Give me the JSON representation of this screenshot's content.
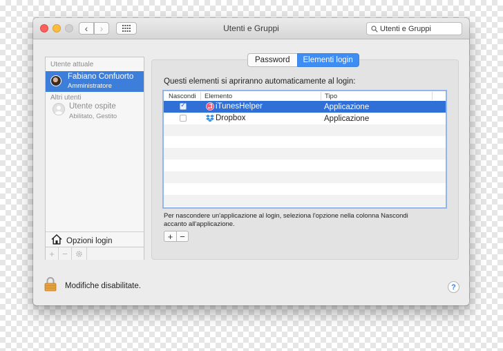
{
  "window": {
    "title": "Utenti e Gruppi",
    "search_value": "Utenti e Gruppi"
  },
  "sidebar": {
    "current_user_header": "Utente attuale",
    "current_user": {
      "name": "Fabiano Confuorto",
      "role": "Amministratore"
    },
    "other_users_header": "Altri utenti",
    "guest": {
      "name": "Utente ospite",
      "status": "Abilitato, Gestito"
    },
    "login_options_label": "Opzioni login",
    "buttons": [
      "+",
      "−",
      "gear"
    ]
  },
  "tabs": [
    {
      "label": "Password",
      "active": false
    },
    {
      "label": "Elementi login",
      "active": true
    }
  ],
  "login_items": {
    "heading": "Questi elementi si apriranno automaticamente al login:",
    "columns": [
      "Nascondi",
      "Elemento",
      "Tipo"
    ],
    "rows": [
      {
        "hide": true,
        "icon": "itunes-icon",
        "name": "iTunesHelper",
        "type": "Applicazione",
        "selected": true
      },
      {
        "hide": false,
        "icon": "dropbox-icon",
        "name": "Dropbox",
        "type": "Applicazione",
        "selected": false
      }
    ],
    "hint": "Per nascondere un'applicazione al login, seleziona l'opzione nella colonna Nascondi accanto all'applicazione.",
    "add_label": "+",
    "remove_label": "−"
  },
  "footer": {
    "lock_text": "Modifiche disabilitate.",
    "help_label": "?"
  },
  "colors": {
    "selection": "#3d7edb",
    "tab_active": "#3e8df2",
    "close": "#fc605c",
    "minimize": "#fdbc40"
  }
}
